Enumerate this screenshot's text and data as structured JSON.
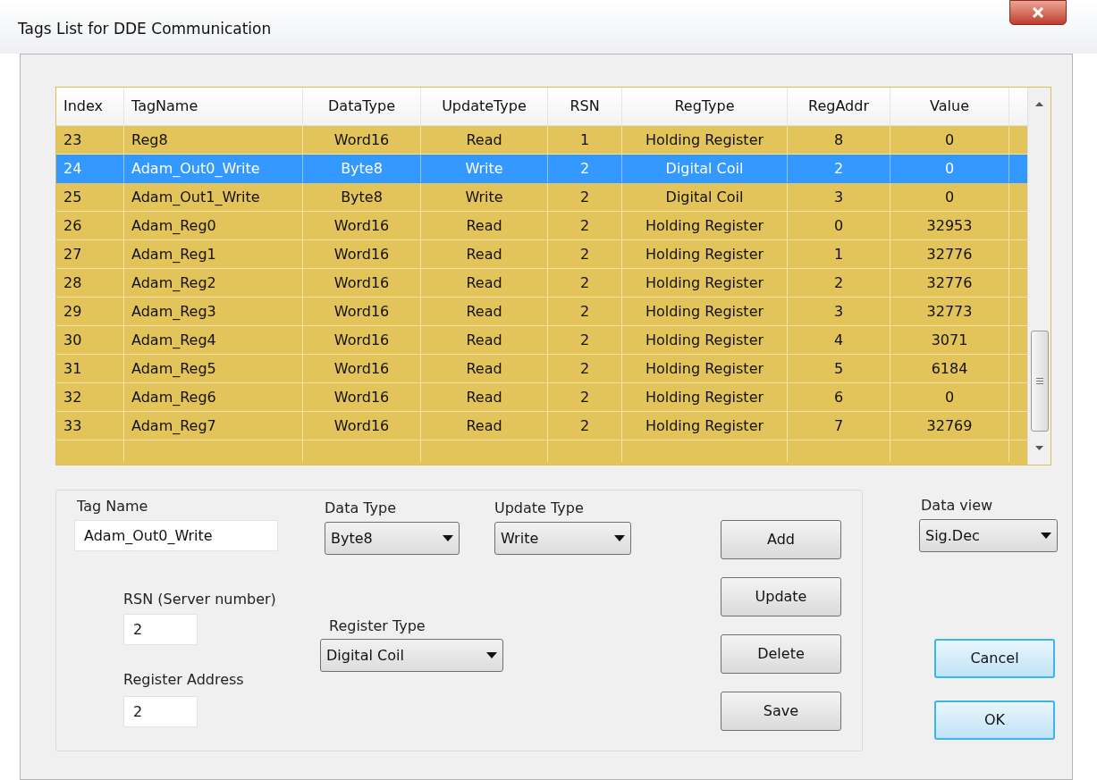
{
  "window": {
    "title": "Tags List for DDE Communication"
  },
  "table": {
    "columns": [
      "Index",
      "TagName",
      "DataType",
      "UpdateType",
      "RSN",
      "RegType",
      "RegAddr",
      "Value"
    ],
    "rows": [
      {
        "cells": [
          "23",
          "Reg8",
          "Word16",
          "Read",
          "1",
          "Holding Register",
          "8",
          "0"
        ],
        "selected": false
      },
      {
        "cells": [
          "24",
          "Adam_Out0_Write",
          "Byte8",
          "Write",
          "2",
          "Digital Coil",
          "2",
          "0"
        ],
        "selected": true
      },
      {
        "cells": [
          "25",
          "Adam_Out1_Write",
          "Byte8",
          "Write",
          "2",
          "Digital Coil",
          "3",
          "0"
        ],
        "selected": false
      },
      {
        "cells": [
          "26",
          "Adam_Reg0",
          "Word16",
          "Read",
          "2",
          "Holding Register",
          "0",
          "32953"
        ],
        "selected": false
      },
      {
        "cells": [
          "27",
          "Adam_Reg1",
          "Word16",
          "Read",
          "2",
          "Holding Register",
          "1",
          "32776"
        ],
        "selected": false
      },
      {
        "cells": [
          "28",
          "Adam_Reg2",
          "Word16",
          "Read",
          "2",
          "Holding Register",
          "2",
          "32776"
        ],
        "selected": false
      },
      {
        "cells": [
          "29",
          "Adam_Reg3",
          "Word16",
          "Read",
          "2",
          "Holding Register",
          "3",
          "32773"
        ],
        "selected": false
      },
      {
        "cells": [
          "30",
          "Adam_Reg4",
          "Word16",
          "Read",
          "2",
          "Holding Register",
          "4",
          "3071"
        ],
        "selected": false
      },
      {
        "cells": [
          "31",
          "Adam_Reg5",
          "Word16",
          "Read",
          "2",
          "Holding Register",
          "5",
          "6184"
        ],
        "selected": false
      },
      {
        "cells": [
          "32",
          "Adam_Reg6",
          "Word16",
          "Read",
          "2",
          "Holding Register",
          "6",
          "0"
        ],
        "selected": false
      },
      {
        "cells": [
          "33",
          "Adam_Reg7",
          "Word16",
          "Read",
          "2",
          "Holding Register",
          "7",
          "32769"
        ],
        "selected": false
      }
    ]
  },
  "form": {
    "tag_name": {
      "label": "Tag Name",
      "value": "Adam_Out0_Write"
    },
    "data_type": {
      "label": "Data Type",
      "value": "Byte8"
    },
    "update_type": {
      "label": "Update Type",
      "value": "Write"
    },
    "rsn": {
      "label": "RSN (Server number)",
      "value": "2"
    },
    "register_type": {
      "label": "Register Type",
      "value": "Digital Coil"
    },
    "register_address": {
      "label": "Register Address",
      "value": "2"
    },
    "buttons": [
      "Add",
      "Update",
      "Delete",
      "Save"
    ]
  },
  "data_view": {
    "label": "Data view",
    "value": "Sig.Dec"
  },
  "dialog_buttons": [
    "Cancel",
    "OK"
  ]
}
